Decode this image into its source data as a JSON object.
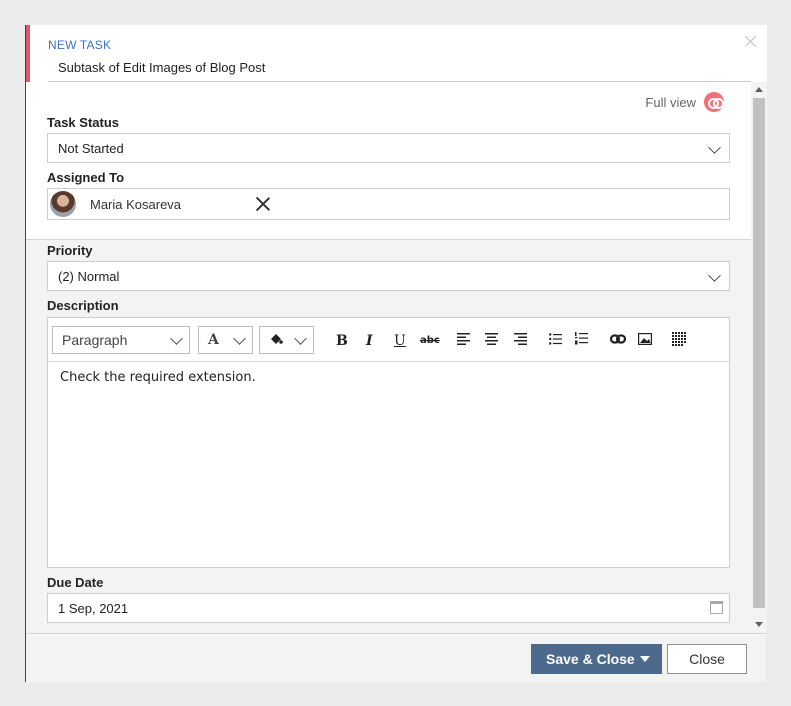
{
  "header": {
    "eyebrow": "NEW TASK",
    "title": "Subtask of Edit Images of Blog Post"
  },
  "full_view": {
    "label": "Full view",
    "icon": "toggle-view-icon",
    "accent": "#f46f79"
  },
  "form": {
    "task_status": {
      "label": "Task Status",
      "value": "Not Started"
    },
    "assigned_to": {
      "label": "Assigned To",
      "value": "Maria Kosareva"
    },
    "priority": {
      "label": "Priority",
      "value": "(2) Normal"
    },
    "description": {
      "label": "Description",
      "text": "Check the required extension.",
      "toolbar": {
        "block_format": "Paragraph",
        "font_color_glyph": "A",
        "bold": "B",
        "italic": "I",
        "underline": "U",
        "strike": "abc"
      }
    },
    "due_date": {
      "label": "Due Date",
      "value": "1 Sep, 2021"
    }
  },
  "footer": {
    "save_label": "Save & Close",
    "close_label": "Close",
    "save_color": "#4d6a8d"
  },
  "colors": {
    "accent_bar": "#e1566b",
    "eyebrow": "#3e74c6"
  }
}
